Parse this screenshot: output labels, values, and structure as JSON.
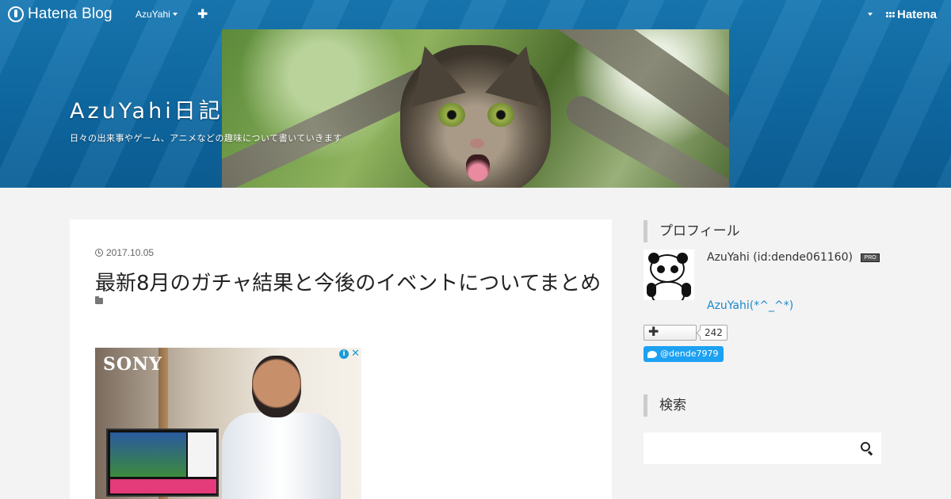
{
  "topbar": {
    "logo_text": "Hatena Blog",
    "user_menu_label": "AzuYahi",
    "add_label": "✚",
    "hatena_label": "Hatena"
  },
  "blog": {
    "title": "AzuYahi日記",
    "description": "日々の出来事やゲーム、アニメなどの趣味について書いていきます"
  },
  "entry": {
    "date": "2017.10.05",
    "title": "最新8月のガチャ結果と今後のイベントについてまとめ",
    "ad": {
      "brand": "SONY",
      "info_label": "i",
      "close_label": "✕"
    }
  },
  "sidebar": {
    "profile_heading": "プロフィール",
    "profile_name": "AzuYahi (id:dende061160)",
    "pro_badge": "PRO",
    "profile_link": "AzuYahi(*^_^*)",
    "subscribe_label": "✚",
    "subscriber_count": "242",
    "twitter_label": "@dende7979",
    "search_heading": "検索",
    "search_placeholder": ""
  },
  "colors": {
    "header_blue": "#1878b3",
    "link_blue": "#1a89c9",
    "twitter_blue": "#1da1f2"
  }
}
